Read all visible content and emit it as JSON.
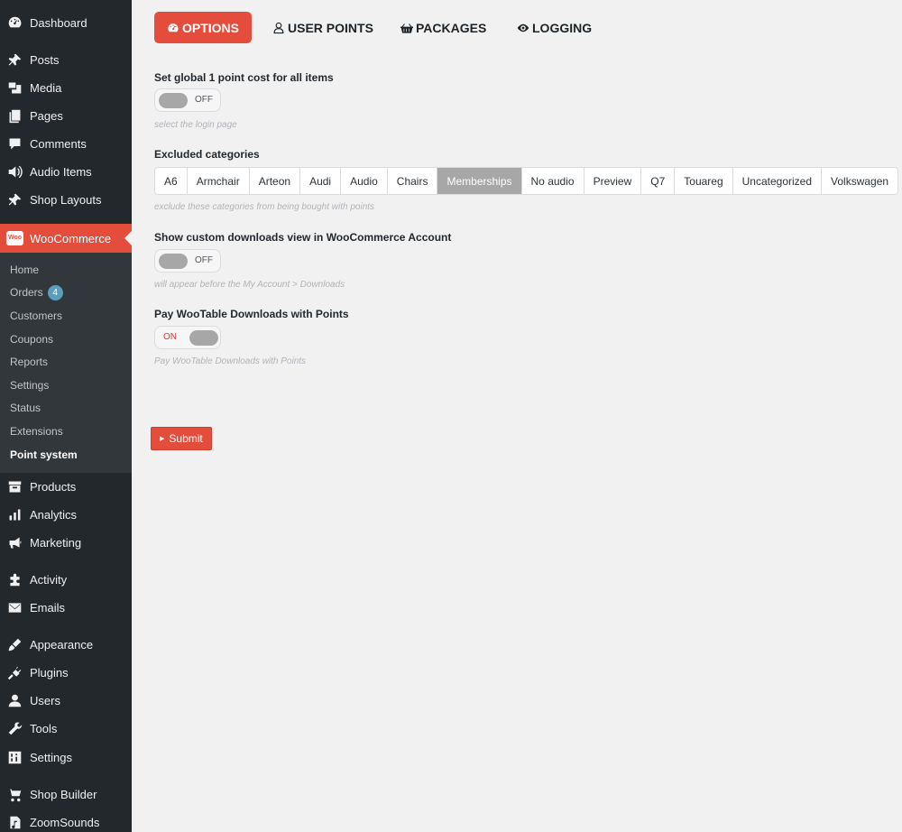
{
  "sidebar": {
    "top_items": [
      {
        "label": "Dashboard",
        "icon": "dashboard-icon"
      },
      {
        "label": "Posts",
        "icon": "pin-icon"
      },
      {
        "label": "Media",
        "icon": "media-icon"
      },
      {
        "label": "Pages",
        "icon": "pages-icon"
      },
      {
        "label": "Comments",
        "icon": "comment-icon"
      },
      {
        "label": "Audio Items",
        "icon": "speaker-icon"
      },
      {
        "label": "Shop Layouts",
        "icon": "pin-icon"
      }
    ],
    "woocommerce": {
      "label": "WooCommerce",
      "logo_text": "Woo"
    },
    "submenu": [
      {
        "label": "Home"
      },
      {
        "label": "Orders",
        "count": "4"
      },
      {
        "label": "Customers"
      },
      {
        "label": "Coupons"
      },
      {
        "label": "Reports"
      },
      {
        "label": "Settings"
      },
      {
        "label": "Status"
      },
      {
        "label": "Extensions"
      },
      {
        "label": "Point system"
      }
    ],
    "bottom_items": [
      {
        "label": "Products",
        "icon": "archive-icon"
      },
      {
        "label": "Analytics",
        "icon": "bar-chart-icon"
      },
      {
        "label": "Marketing",
        "icon": "megaphone-icon"
      },
      {
        "label": "Activity",
        "icon": "puzzle-icon"
      },
      {
        "label": "Emails",
        "icon": "envelope-icon"
      },
      {
        "label": "Appearance",
        "icon": "brush-icon"
      },
      {
        "label": "Plugins",
        "icon": "plug-icon"
      },
      {
        "label": "Users",
        "icon": "user-icon"
      },
      {
        "label": "Tools",
        "icon": "wrench-icon"
      },
      {
        "label": "Settings",
        "icon": "sliders-icon"
      },
      {
        "label": "Shop Builder",
        "icon": "cart-icon"
      },
      {
        "label": "ZoomSounds",
        "icon": "music-file-icon"
      }
    ]
  },
  "tabs": [
    {
      "label": "OPTIONS",
      "icon": "dashboard-gauge-icon",
      "active": true
    },
    {
      "label": "USER POINTS",
      "icon": "user-outline-icon"
    },
    {
      "label": "PACKAGES",
      "icon": "basket-icon"
    },
    {
      "label": "LOGGING",
      "icon": "eye-icon"
    }
  ],
  "fields": {
    "global_cost": {
      "label": "Set global 1 point cost for all items",
      "state": "OFF",
      "help": "select the login page"
    },
    "excluded": {
      "label": "Excluded categories",
      "help": "exclude these categories from being bought with points"
    },
    "custom_downloads": {
      "label": "Show custom downloads view in WooCommerce Account",
      "state": "OFF",
      "help": "will appear before the My Account > Downloads"
    },
    "wootable": {
      "label": "Pay WooTable Downloads with Points",
      "state": "ON",
      "help": "Pay WooTable Downloads with Points"
    }
  },
  "categories": [
    {
      "label": "A6"
    },
    {
      "label": "Armchair"
    },
    {
      "label": "Arteon"
    },
    {
      "label": "Audi"
    },
    {
      "label": "Audio"
    },
    {
      "label": "Chairs"
    },
    {
      "label": "Memberships",
      "selected": true
    },
    {
      "label": "No audio"
    },
    {
      "label": "Preview"
    },
    {
      "label": "Q7"
    },
    {
      "label": "Touareg"
    },
    {
      "label": "Uncategorized"
    },
    {
      "label": "Volkswagen"
    }
  ],
  "submit": {
    "label": "Submit"
  },
  "colors": {
    "accent": "#e44c3b",
    "sidebar": "#23282d",
    "submenu": "#32373c",
    "selected_category": "#a7a7a7"
  }
}
